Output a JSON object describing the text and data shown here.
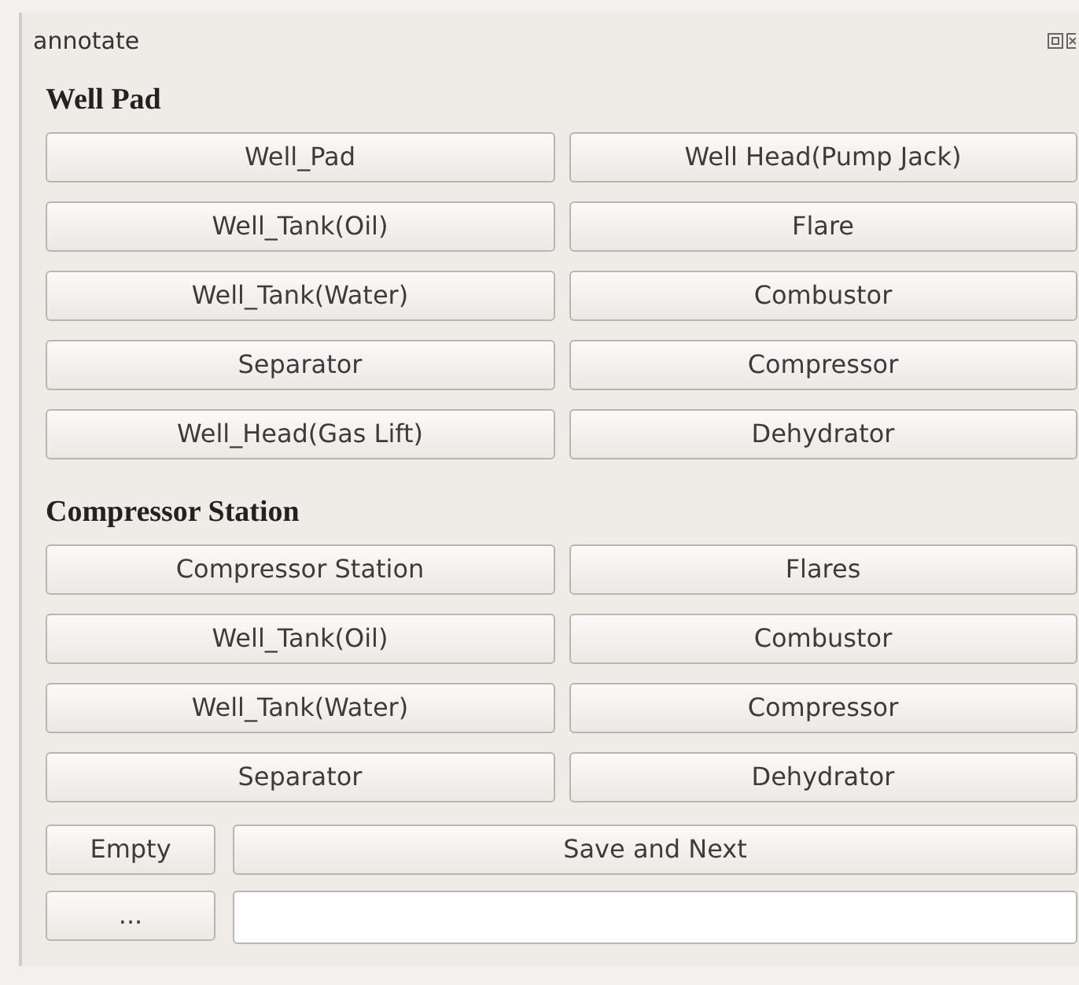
{
  "window": {
    "title": "annotate"
  },
  "sections": [
    {
      "heading": "Well Pad",
      "buttons": [
        "Well_Pad",
        "Well Head(Pump Jack)",
        "Well_Tank(Oil)",
        "Flare",
        "Well_Tank(Water)",
        "Combustor",
        "Separator",
        "Compressor",
        "Well_Head(Gas Lift)",
        "Dehydrator"
      ]
    },
    {
      "heading": "Compressor Station",
      "buttons": [
        "Compressor Station",
        "Flares",
        "Well_Tank(Oil)",
        "Combustor",
        "Well_Tank(Water)",
        "Compressor",
        "Separator",
        "Dehydrator"
      ]
    }
  ],
  "footer": {
    "empty_button": "Empty",
    "save_button": "Save and Next",
    "browse_button": "..."
  }
}
